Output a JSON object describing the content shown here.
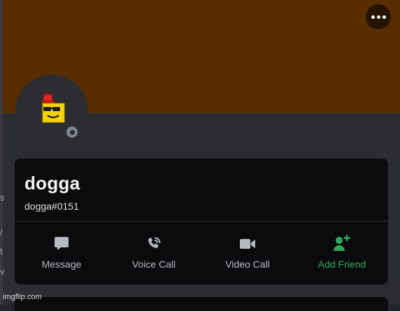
{
  "profile": {
    "display_name": "dogga",
    "username": "dogga#0151",
    "status": "offline",
    "banner_color": "#582d00"
  },
  "actions": [
    {
      "label": "Message",
      "icon": "message-icon"
    },
    {
      "label": "Voice Call",
      "icon": "phone-call-icon"
    },
    {
      "label": "Video Call",
      "icon": "video-camera-icon"
    },
    {
      "label": "Add Friend",
      "icon": "add-friend-icon"
    }
  ],
  "left_fragments": [
    "s",
    "/",
    "t",
    "v"
  ],
  "watermark": "imgflip.com",
  "colors": {
    "accent_green": "#2dab5e",
    "card_bg": "#0b0b0d",
    "body_bg": "#2b2d31"
  }
}
